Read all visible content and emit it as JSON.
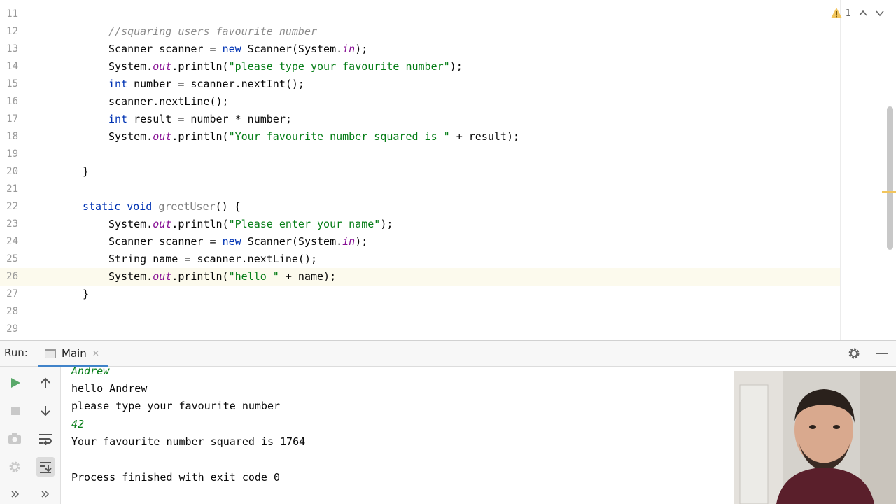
{
  "editor": {
    "lines": [
      {
        "n": "11"
      },
      {
        "n": "12",
        "comment": "//squaring users favourite number"
      },
      {
        "n": "13",
        "t1": "Scanner scanner = ",
        "kw": "new",
        "t2": " Scanner(System.",
        "fld": "in",
        "t3": ");"
      },
      {
        "n": "14",
        "t1": "System.",
        "fld": "out",
        "t2": ".println(",
        "str": "\"please type your favourite number\"",
        "t3": ");"
      },
      {
        "n": "15",
        "kw": "int",
        "t1": " number = scanner.nextInt();"
      },
      {
        "n": "16",
        "t1": "scanner.nextLine();"
      },
      {
        "n": "17",
        "kw": "int",
        "t1": " result = number * number;"
      },
      {
        "n": "18",
        "t1": "System.",
        "fld": "out",
        "t2": ".println(",
        "str": "\"Your favourite number squared is \"",
        "t3": " + result);"
      },
      {
        "n": "19"
      },
      {
        "n": "20",
        "t1": "}"
      },
      {
        "n": "21"
      },
      {
        "n": "22",
        "kw": "static void",
        "method": "greetUser",
        "t1": "() {"
      },
      {
        "n": "23",
        "t1": "System.",
        "fld": "out",
        "t2": ".println(",
        "str": "\"Please enter your name\"",
        "t3": ");"
      },
      {
        "n": "24",
        "t1": "Scanner scanner = ",
        "kw": "new",
        "t2": " Scanner(System.",
        "fld": "in",
        "t3": ");"
      },
      {
        "n": "25",
        "t1": "String name = scanner.nextLine();"
      },
      {
        "n": "26",
        "t1": "System.",
        "fld": "out",
        "t2": ".println(",
        "str": "\"hello \"",
        "t3": " + name);"
      },
      {
        "n": "27",
        "t1": "}"
      },
      {
        "n": "28"
      },
      {
        "n": "29"
      }
    ],
    "warnings_count": "1"
  },
  "run": {
    "label": "Run:",
    "tab_label": "Main",
    "close_glyph": "✕",
    "console": [
      {
        "text": "Andrew",
        "type": "input"
      },
      {
        "text": "hello Andrew",
        "type": "output"
      },
      {
        "text": "please type your favourite number",
        "type": "output"
      },
      {
        "text": "42",
        "type": "input"
      },
      {
        "text": "Your favourite number squared is 1764",
        "type": "output"
      },
      {
        "text": "",
        "type": "output"
      },
      {
        "text": "Process finished with exit code 0",
        "type": "output"
      }
    ]
  },
  "icons": {
    "warning": "warning-icon",
    "prev": "chevron-up-icon",
    "next": "chevron-down-icon",
    "rerun": "play-icon",
    "stop": "stop-icon",
    "up": "arrow-up-icon",
    "down": "arrow-down-icon",
    "camera": "camera-icon",
    "wrap": "soft-wrap-icon",
    "settings": "gear-icon",
    "scroll_end": "scroll-to-end-icon",
    "more": "double-chevron-icon"
  },
  "colors": {
    "keyword": "#0033b3",
    "field": "#871094",
    "string": "#067d17",
    "comment": "#8c8c8c",
    "run_green": "#59a869",
    "tab_accent": "#4083c9",
    "warning": "#f2c55c"
  }
}
